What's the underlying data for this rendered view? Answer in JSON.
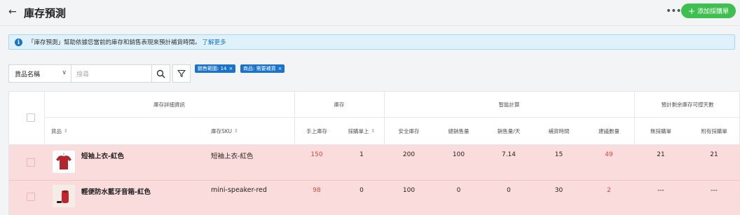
{
  "header": {
    "title": "庫存預測",
    "add_button_label": "添加採購單"
  },
  "banner": {
    "text": "「庫存預測」幫助依據您當前的庫存和銷售表現來預計補貨時間。",
    "link": "了解更多"
  },
  "filters": {
    "field_select": "貨品名稱",
    "search_placeholder": "搜尋",
    "chips": [
      "銷售範圍: 14",
      "商品: 需要補貨"
    ]
  },
  "table": {
    "groups": [
      "庫存詳細資訊",
      "庫存",
      "智能計算",
      "預計剩余庫存可撐天數"
    ],
    "columns": [
      "貨品",
      "庫存SKU",
      "手上庫存",
      "採購單上",
      "安全庫存",
      "總銷售量",
      "銷售量/天",
      "補貨時間",
      "建議數量",
      "無採購單",
      "附有採購單"
    ],
    "rows": [
      {
        "name": "短袖上衣-紅色",
        "sku": "短袖上衣-紅色",
        "on_hand": "150",
        "on_po": "1",
        "safety": "200",
        "total_sales": "100",
        "per_day": "7.14",
        "lead_time": "15",
        "suggested": "49",
        "no_po": "21",
        "with_po": "21"
      },
      {
        "name": "輕便防水藍牙音箱-紅色",
        "sku": "mini-speaker-red",
        "on_hand": "98",
        "on_po": "0",
        "safety": "100",
        "total_sales": "0",
        "per_day": "0",
        "lead_time": "30",
        "suggested": "2",
        "no_po": "---",
        "with_po": "---"
      }
    ]
  },
  "colors": {
    "accent_green": "#3fbf4f",
    "link_blue": "#1a73c8",
    "alert_red": "#e0433c",
    "row_highlight": "#fbdcdc"
  }
}
